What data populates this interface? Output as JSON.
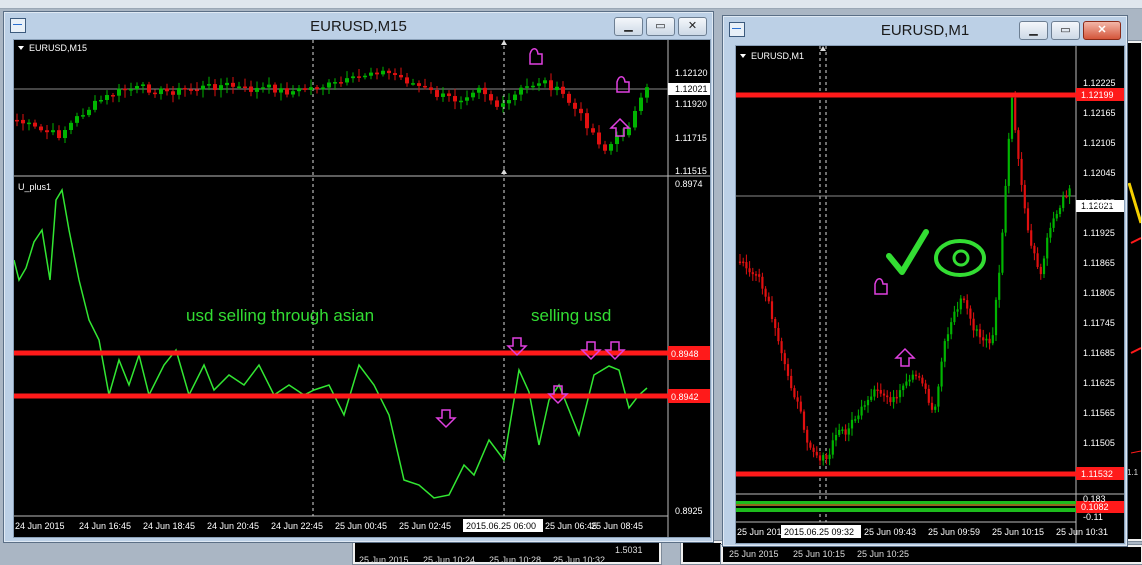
{
  "left_window": {
    "title": "EURUSD,M15",
    "main_label": "EURUSD,M15",
    "indicator_label": "U_plus1",
    "price_ticks": [
      "1.12120",
      "1.11920",
      "1.11715",
      "1.11515"
    ],
    "current_price": "1.12021",
    "ind_ticks": [
      "0.8974",
      "0.8925"
    ],
    "line_tag_1": "0.8948",
    "line_tag_2": "0.8942",
    "time_labels": [
      "24 Jun 2015",
      "24 Jun 16:45",
      "24 Jun 18:45",
      "24 Jun 20:45",
      "24 Jun 22:45",
      "25 Jun 00:45",
      "25 Jun 02:45",
      "25 Jun 06:45",
      "25 Jun 08:45"
    ],
    "cursor_time": "2015.06.25 06:00",
    "note_1": "usd selling through asian",
    "note_2": "selling usd"
  },
  "right_window": {
    "title": "EURUSD,M1",
    "main_label": "EURUSD,M1",
    "price_ticks": [
      "1.12225",
      "1.12165",
      "1.12105",
      "1.12045",
      "1.11985",
      "1.11925",
      "1.11865",
      "1.11805",
      "1.11745",
      "1.11685",
      "1.11625",
      "1.11565",
      "1.11505"
    ],
    "current_price": "1.12021",
    "red_tag_top": "1.12199",
    "red_tag_bottom": "1.11532",
    "ind_tag": "0.1082",
    "ind_ticks": [
      "0.183",
      "-0.11"
    ],
    "time_labels": [
      "25 Jun 201",
      "25 Jun 09:43",
      "25 Jun 09:59",
      "25 Jun 10:15",
      "25 Jun 10:31"
    ],
    "cursor_time": "2015.06.25 09:32"
  },
  "background": {
    "labels": [
      "1.5031",
      "25 Jun 2015",
      "25 Jun 10:24",
      "25 Jun 10:28",
      "25 Jun 10:32",
      "25 Jun 2015",
      "25 Jun 10:15",
      "25 Jun 10:25",
      "1.1"
    ]
  },
  "colors": {
    "bull": "#00b400",
    "bear": "#e01010",
    "indicator": "#32e632",
    "level_line": "#ff1a1a",
    "annotation": "#e040e0",
    "note_text": "#33dd33"
  }
}
